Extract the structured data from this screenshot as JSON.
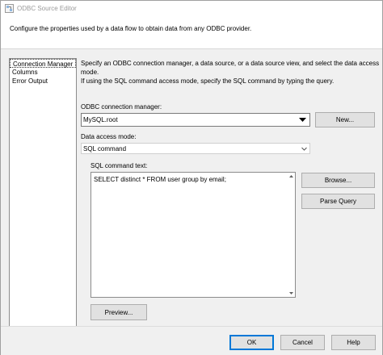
{
  "window": {
    "title": "ODBC Source Editor",
    "description": "Configure the properties used by a data flow to obtain data from any ODBC provider."
  },
  "nav": {
    "items": [
      {
        "label": "Connection Manager",
        "selected": true
      },
      {
        "label": "Columns",
        "selected": false
      },
      {
        "label": "Error Output",
        "selected": false
      }
    ]
  },
  "main": {
    "intro_line1": "Specify an ODBC connection manager, a data source, or a data source view, and select the data access mode.",
    "intro_line2": "If using the SQL command access mode, specify the SQL command by typing the query.",
    "connection_manager_label": "ODBC connection manager:",
    "connection_manager_value": "MySQL.root",
    "new_button": "New...",
    "access_mode_label": "Data access mode:",
    "access_mode_value": "SQL command",
    "sql_label": "SQL command text:",
    "sql_text": "SELECT distinct * FROM user group by email;",
    "browse_button": "Browse...",
    "parse_button": "Parse Query",
    "preview_button": "Preview..."
  },
  "footer": {
    "ok": "OK",
    "cancel": "Cancel",
    "help": "Help"
  },
  "colors": {
    "window_bg": "#f0f0f0",
    "focus_border": "#0078d7",
    "button_bg": "#e1e1e1"
  }
}
